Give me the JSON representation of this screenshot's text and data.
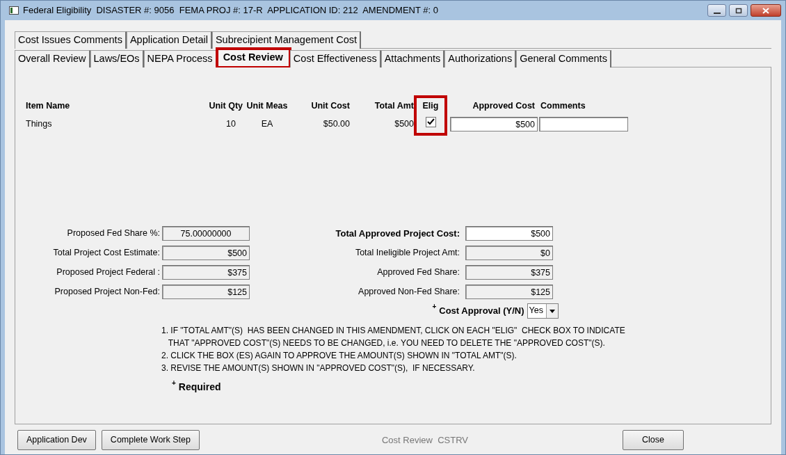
{
  "window": {
    "title": "Federal Eligibility  DISASTER #: 9056  FEMA PROJ #: 17-R  APPLICATION ID: 212  AMENDMENT #: 0"
  },
  "tab_rows": [
    [
      {
        "label": "Cost Issues Comments",
        "selected": false,
        "highlighted": false
      },
      {
        "label": "Application Detail",
        "selected": false,
        "highlighted": false
      },
      {
        "label": "Subrecipient Management Cost",
        "selected": false,
        "highlighted": false
      }
    ],
    [
      {
        "label": "Overall Review",
        "selected": false,
        "highlighted": false
      },
      {
        "label": "Laws/EOs",
        "selected": false,
        "highlighted": false
      },
      {
        "label": "NEPA Process",
        "selected": false,
        "highlighted": false
      },
      {
        "label": "Cost Review",
        "selected": true,
        "highlighted": true
      },
      {
        "label": "Cost Effectiveness",
        "selected": false,
        "highlighted": false
      },
      {
        "label": "Attachments",
        "selected": false,
        "highlighted": false
      },
      {
        "label": "Authorizations",
        "selected": false,
        "highlighted": false
      },
      {
        "label": "General Comments",
        "selected": false,
        "highlighted": false
      }
    ]
  ],
  "items_table": {
    "columns": [
      "Item Name",
      "Unit Qty",
      "Unit Meas",
      "Unit Cost",
      "Total Amt",
      "Elig",
      "Approved Cost",
      "Comments"
    ],
    "elig_highlighted": true,
    "rows": [
      {
        "item_name": "Things",
        "unit_qty": "10",
        "unit_meas": "EA",
        "unit_cost": "$50.00",
        "total_amt": "$500",
        "elig": true,
        "approved_cost": "$500"
      }
    ]
  },
  "proposed_fields": [
    {
      "label": "Proposed Fed Share %:",
      "value": "75.00000000"
    },
    {
      "label": "Total Project Cost Estimate:",
      "value": "$500"
    },
    {
      "label": "Proposed Project Federal :",
      "value": "$375"
    },
    {
      "label": "Proposed Project Non-Fed:",
      "value": "$125"
    }
  ],
  "approved_fields": [
    {
      "label": "Total Approved Project Cost:",
      "value": "$500",
      "editable": true
    },
    {
      "label": "Total Ineligible Project Amt:",
      "value": "$0",
      "editable": false
    },
    {
      "label": "Approved Fed Share:",
      "value": "$375",
      "editable": false
    },
    {
      "label": "Approved Non-Fed Share:",
      "value": "$125",
      "editable": false
    }
  ],
  "cost_approval": {
    "required_mark": "+",
    "label": "Cost Approval (Y/N)",
    "value": "Yes"
  },
  "instructions": [
    "1. IF \"TOTAL AMT\"(S)  HAS BEEN CHANGED IN THIS AMENDMENT, CLICK ON EACH \"ELIG\"  CHECK BOX TO INDICATE",
    "   THAT \"APPROVED COST\"(S) NEEDS TO BE CHANGED, i.e. YOU NEED TO DELETE THE \"APPROVED COST\"(S).",
    "2. CLICK THE BOX (ES) AGAIN TO APPROVE THE AMOUNT(S) SHOWN IN \"TOTAL AMT\"(S).",
    "3. REVISE THE AMOUNT(S) SHOWN IN \"APPROVED COST\"(S),  IF NECESSARY."
  ],
  "required_note": {
    "mark": "+",
    "label": "Required"
  },
  "footer": {
    "left_buttons": [
      "Application Dev",
      "Complete Work Step"
    ],
    "status": "Cost Review  CSTRV",
    "right_button": "Close"
  }
}
